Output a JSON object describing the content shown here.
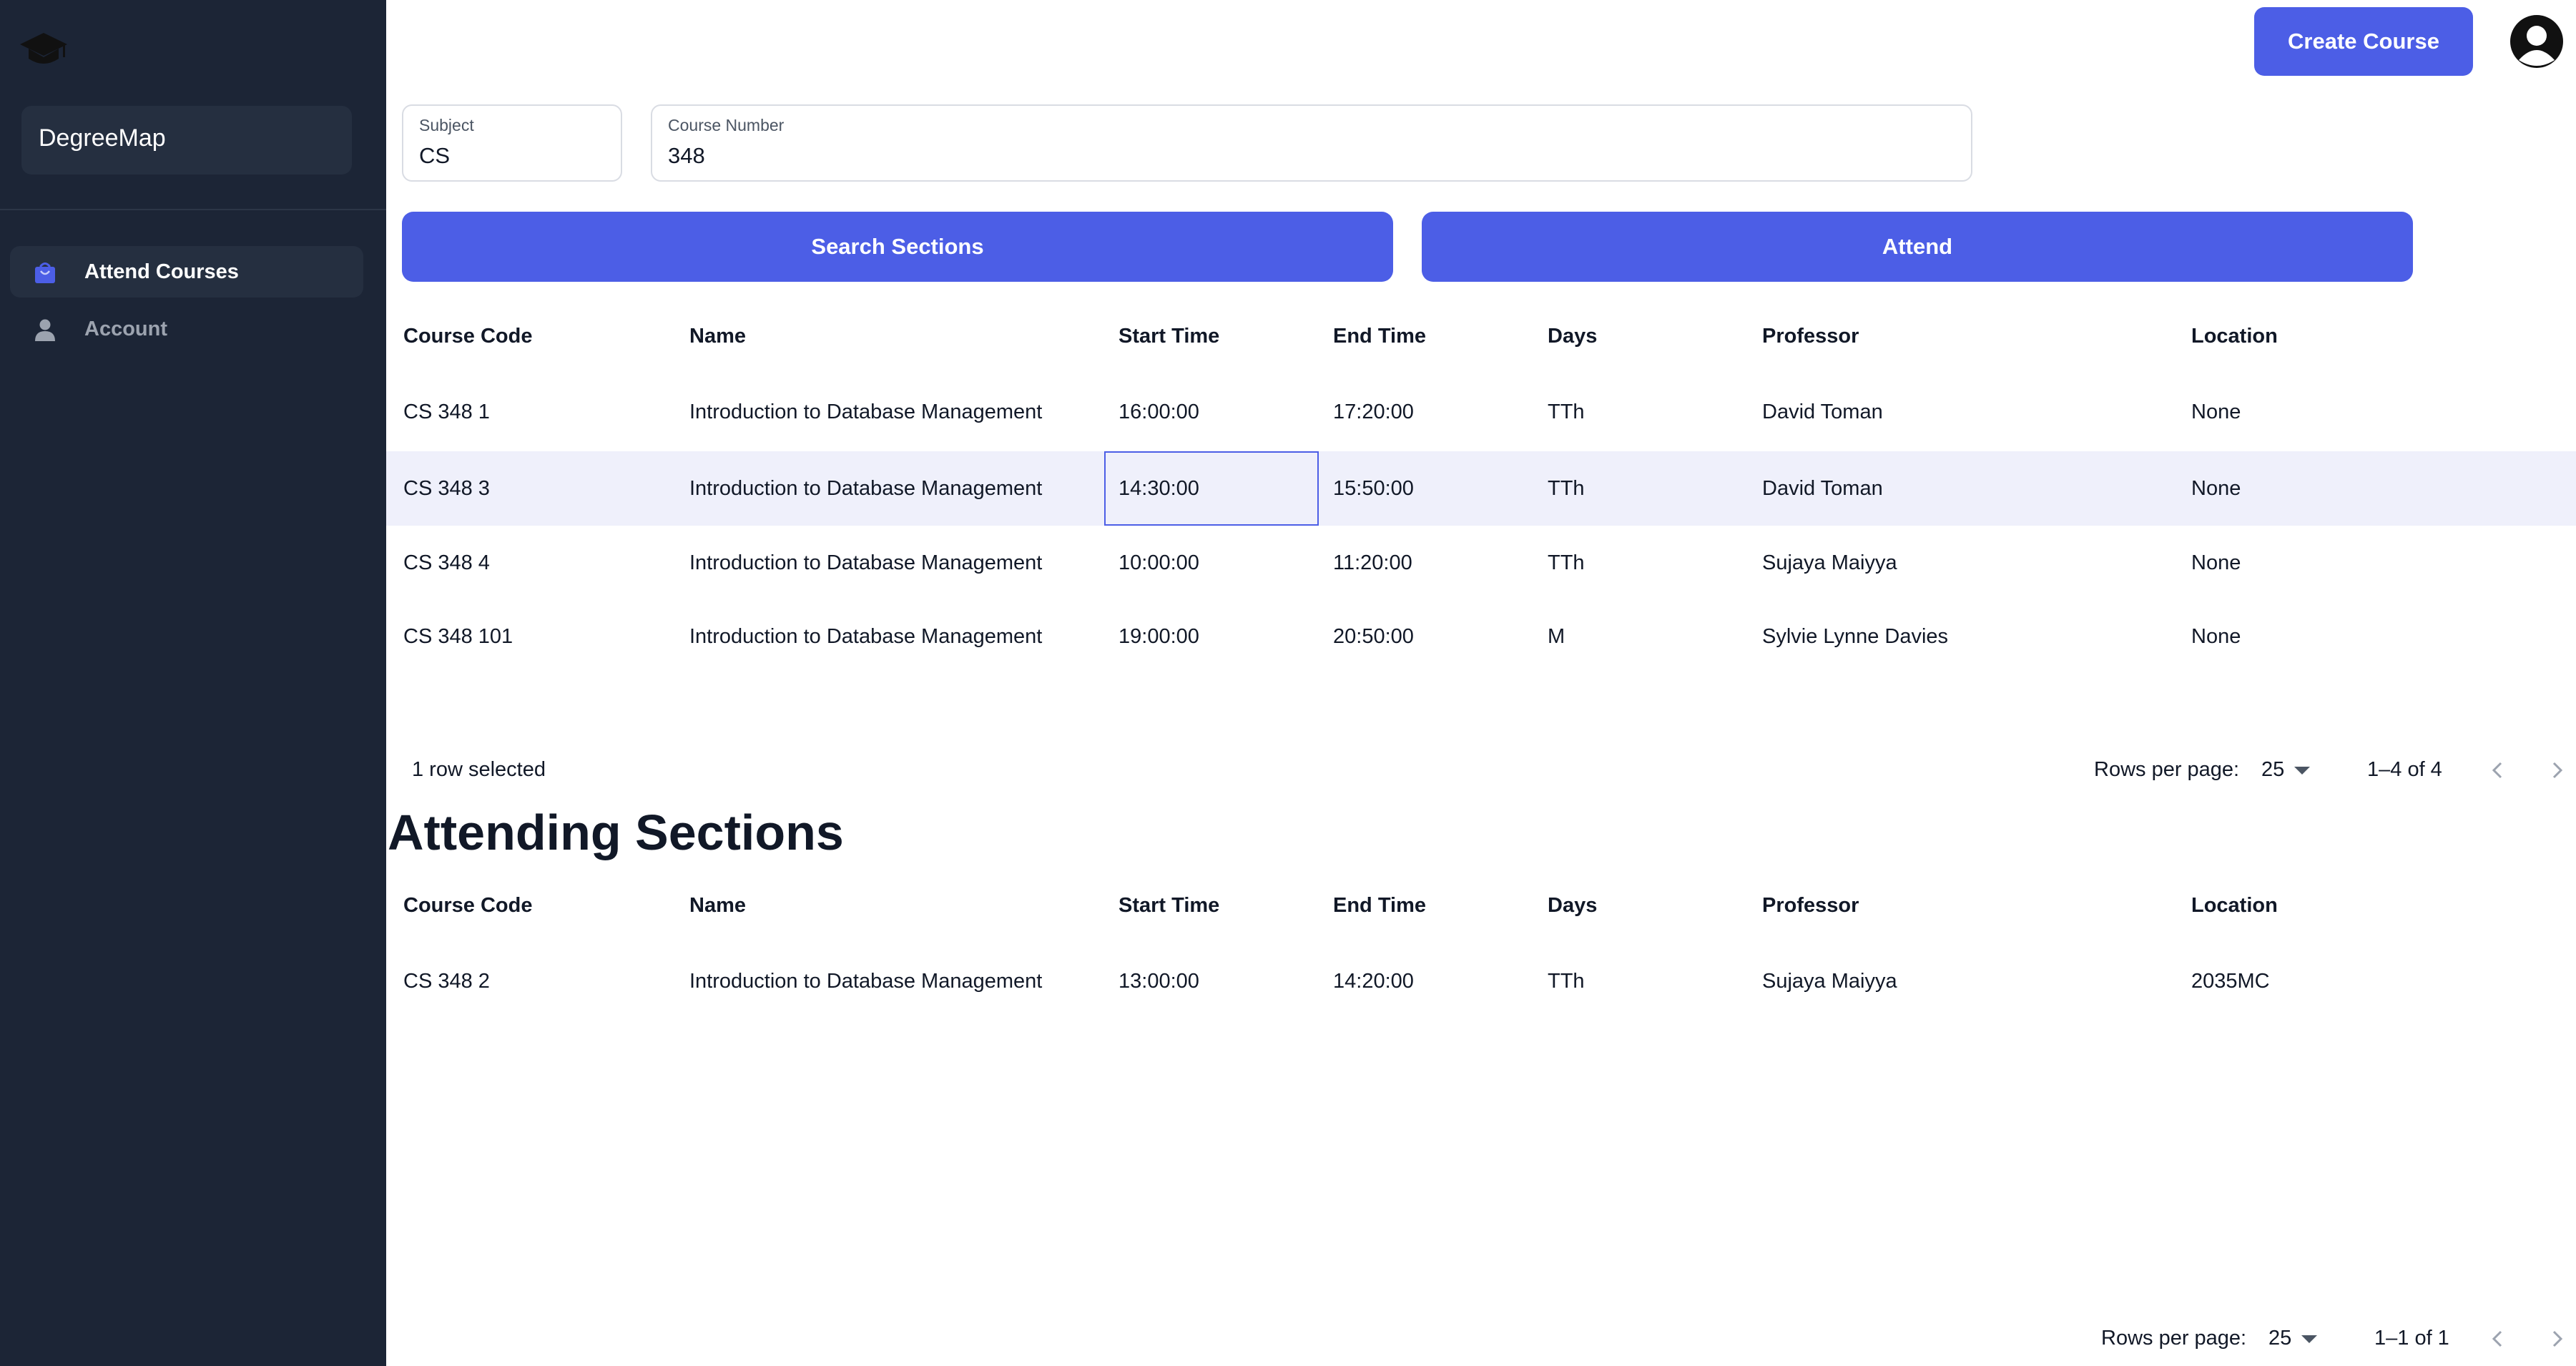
{
  "sidebar": {
    "brand": "DegreeMap",
    "items": [
      {
        "label": "Attend Courses",
        "icon": "shopping-bag-icon",
        "active": true
      },
      {
        "label": "Account",
        "icon": "person-icon",
        "active": false
      }
    ]
  },
  "header": {
    "create_label": "Create Course"
  },
  "search": {
    "subject_label": "Subject",
    "subject_value": "CS",
    "course_number_label": "Course Number",
    "course_number_value": "348",
    "search_button": "Search Sections",
    "attend_button": "Attend"
  },
  "columns": [
    "Course Code",
    "Name",
    "Start Time",
    "End Time",
    "Days",
    "Professor",
    "Location"
  ],
  "sections_table": {
    "rows": [
      {
        "code": "CS 348 1",
        "name": "Introduction to Database Management",
        "start": "16:00:00",
        "end": "17:20:00",
        "days": "TTh",
        "professor": "David Toman",
        "location": "None"
      },
      {
        "code": "CS 348 3",
        "name": "Introduction to Database Management",
        "start": "14:30:00",
        "end": "15:50:00",
        "days": "TTh",
        "professor": "David Toman",
        "location": "None"
      },
      {
        "code": "CS 348 4",
        "name": "Introduction to Database Management",
        "start": "10:00:00",
        "end": "11:20:00",
        "days": "TTh",
        "professor": "Sujaya Maiyya",
        "location": "None"
      },
      {
        "code": "CS 348 101",
        "name": "Introduction to Database Management",
        "start": "19:00:00",
        "end": "20:50:00",
        "days": "M",
        "professor": "Sylvie Lynne Davies",
        "location": "None"
      }
    ],
    "selected_text": "1 row selected",
    "rows_per_page_label": "Rows per page:",
    "rows_per_page_value": "25",
    "range": "1–4 of 4"
  },
  "attending": {
    "title": "Attending Sections",
    "rows": [
      {
        "code": "CS 348 2",
        "name": "Introduction to Database Management",
        "start": "13:00:00",
        "end": "14:20:00",
        "days": "TTh",
        "professor": "Sujaya Maiyya",
        "location": "2035MC"
      }
    ],
    "rows_per_page_label": "Rows per page:",
    "rows_per_page_value": "25",
    "range": "1–1 of 1"
  },
  "colors": {
    "accent": "#4c5ee6",
    "sidebar_bg": "#1c2536",
    "selected_row": "#eff0fb"
  }
}
